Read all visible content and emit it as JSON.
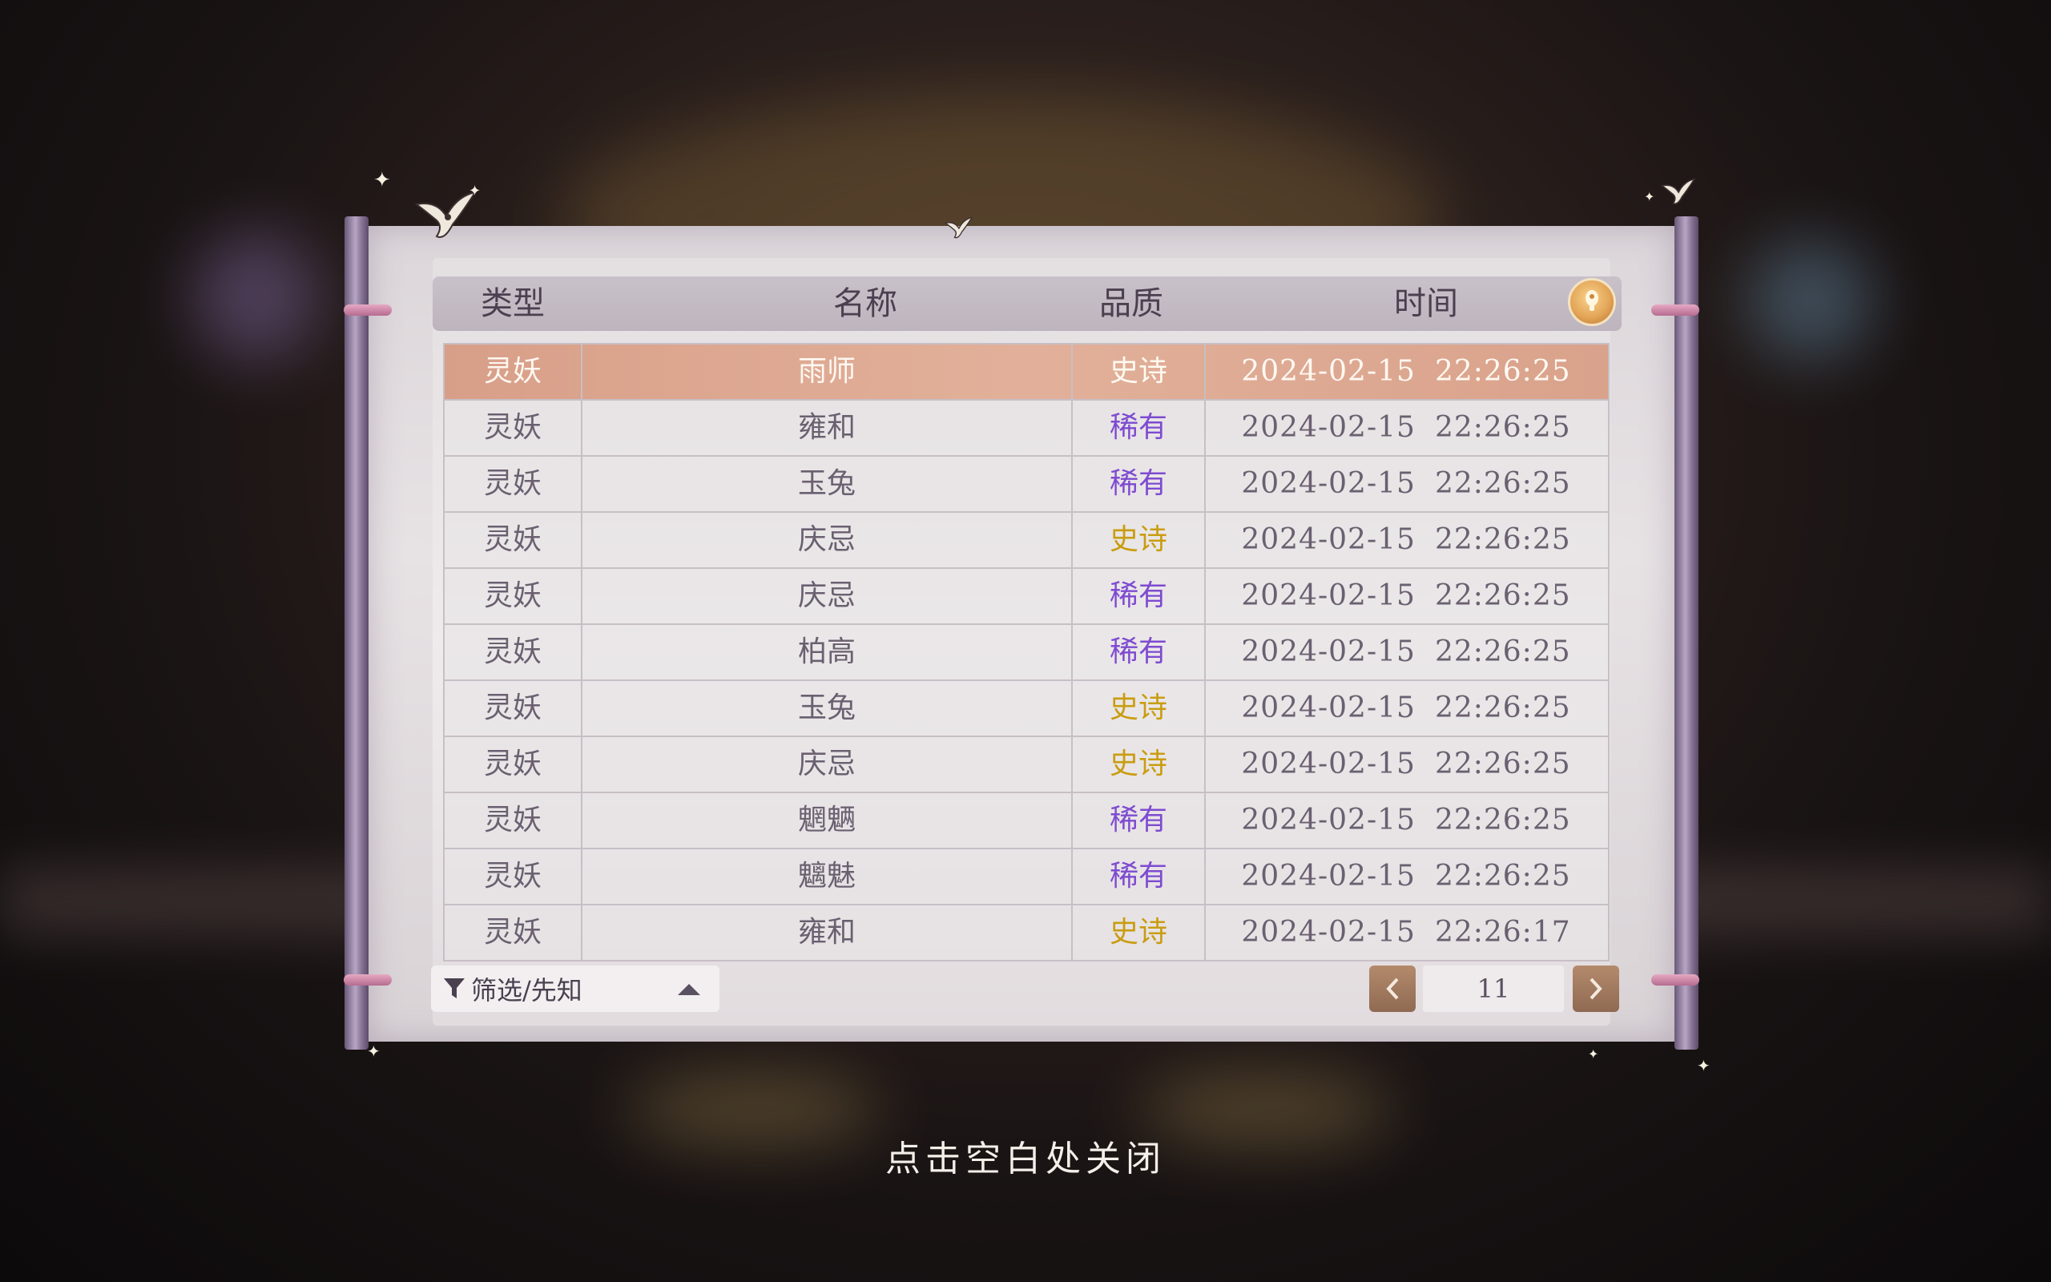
{
  "header": {
    "col_type": "类型",
    "col_name": "名称",
    "col_quality": "品质",
    "col_time": "时间"
  },
  "icons": {
    "info": "info-exclamation-icon",
    "filter": "funnel-icon",
    "dropdown": "triangle-up-icon",
    "prev": "chevron-left-icon",
    "next": "chevron-right-icon"
  },
  "rows": [
    {
      "type": "灵妖",
      "name": "雨师",
      "quality": "史诗",
      "quality_kind": "epic",
      "date": "2024-02-15",
      "time": "22:26:25",
      "highlighted": true
    },
    {
      "type": "灵妖",
      "name": "雍和",
      "quality": "稀有",
      "quality_kind": "rare",
      "date": "2024-02-15",
      "time": "22:26:25"
    },
    {
      "type": "灵妖",
      "name": "玉兔",
      "quality": "稀有",
      "quality_kind": "rare",
      "date": "2024-02-15",
      "time": "22:26:25"
    },
    {
      "type": "灵妖",
      "name": "庆忌",
      "quality": "史诗",
      "quality_kind": "epic",
      "date": "2024-02-15",
      "time": "22:26:25"
    },
    {
      "type": "灵妖",
      "name": "庆忌",
      "quality": "稀有",
      "quality_kind": "rare",
      "date": "2024-02-15",
      "time": "22:26:25"
    },
    {
      "type": "灵妖",
      "name": "柏高",
      "quality": "稀有",
      "quality_kind": "rare",
      "date": "2024-02-15",
      "time": "22:26:25"
    },
    {
      "type": "灵妖",
      "name": "玉兔",
      "quality": "史诗",
      "quality_kind": "epic",
      "date": "2024-02-15",
      "time": "22:26:25"
    },
    {
      "type": "灵妖",
      "name": "庆忌",
      "quality": "史诗",
      "quality_kind": "epic",
      "date": "2024-02-15",
      "time": "22:26:25"
    },
    {
      "type": "灵妖",
      "name": "魍魉",
      "quality": "稀有",
      "quality_kind": "rare",
      "date": "2024-02-15",
      "time": "22:26:25"
    },
    {
      "type": "灵妖",
      "name": "魑魅",
      "quality": "稀有",
      "quality_kind": "rare",
      "date": "2024-02-15",
      "time": "22:26:25"
    },
    {
      "type": "灵妖",
      "name": "雍和",
      "quality": "史诗",
      "quality_kind": "epic",
      "date": "2024-02-15",
      "time": "22:26:17"
    }
  ],
  "filter": {
    "label": "筛选/先知"
  },
  "pager": {
    "page": "11"
  },
  "close_hint": "点击空白处关闭",
  "colors": {
    "rare": "#7e4bd0",
    "epic": "#c99d10",
    "highlight": "#e2b09a"
  }
}
